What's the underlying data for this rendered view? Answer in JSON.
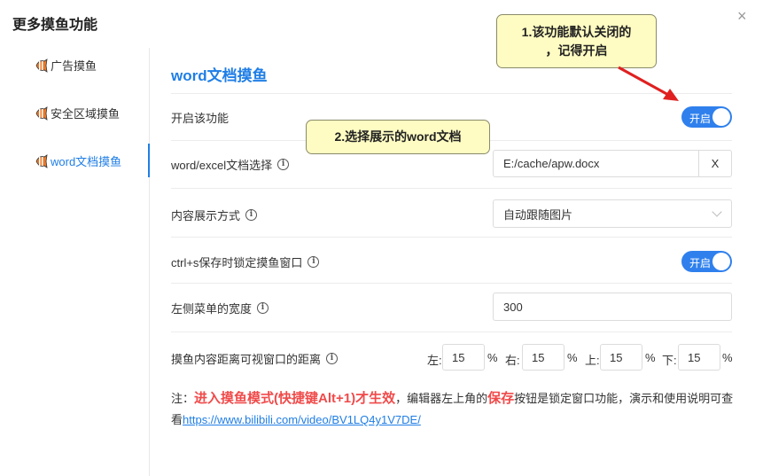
{
  "window": {
    "title": "更多摸鱼功能",
    "close_label": "×"
  },
  "sidebar": {
    "items": [
      {
        "label": "广告摸鱼",
        "icon": "fish-icon"
      },
      {
        "label": "安全区域摸鱼",
        "icon": "fish-icon"
      },
      {
        "label": "word文档摸鱼",
        "icon": "fish-icon",
        "active": true
      }
    ]
  },
  "main": {
    "section_title": "word文档摸鱼",
    "enable": {
      "label": "开启该功能",
      "toggle_text": "开启",
      "state": true
    },
    "file_select": {
      "label": "word/excel文档选择",
      "info": "i",
      "value": "E:/cache/apw.docx",
      "clear_label": "X"
    },
    "display_mode": {
      "label": "内容展示方式",
      "info": "i",
      "value": "自动跟随图片"
    },
    "lock_window": {
      "label": "ctrl+s保存时锁定摸鱼窗口",
      "info": "i",
      "toggle_text": "开启",
      "state": true
    },
    "menu_width": {
      "label": "左侧菜单的宽度",
      "info": "i",
      "value": "300"
    },
    "distance": {
      "label": "摸鱼内容距离可视窗口的距离",
      "info": "i",
      "fields": [
        {
          "label": "左:",
          "value": "15",
          "unit": "%"
        },
        {
          "label": "右:",
          "value": "15",
          "unit": "%"
        },
        {
          "label": "上:",
          "value": "15",
          "unit": "%"
        },
        {
          "label": "下:",
          "value": "15",
          "unit": "%"
        }
      ]
    },
    "note": {
      "prefix": "注：",
      "highlight1": "进入摸鱼模式(快捷键Alt+1)才生效",
      "middle": "，编辑器左上角的",
      "highlight2": "保存",
      "suffix": "按钮是锁定窗口功能，演示和使用说明可查看",
      "link": "https://www.bilibili.com/video/BV1LQ4y1V7DE/"
    }
  },
  "callouts": {
    "first_line1": "1.该功能默认关闭的",
    "first_line2": "，记得开启",
    "second": "2.选择展示的word文档"
  },
  "colors": {
    "accent": "#1f7ee6",
    "toggle": "#2f80ed",
    "warning": "#f04a4a",
    "callout_bg": "#fefcc2",
    "arrow": "#e02020"
  }
}
